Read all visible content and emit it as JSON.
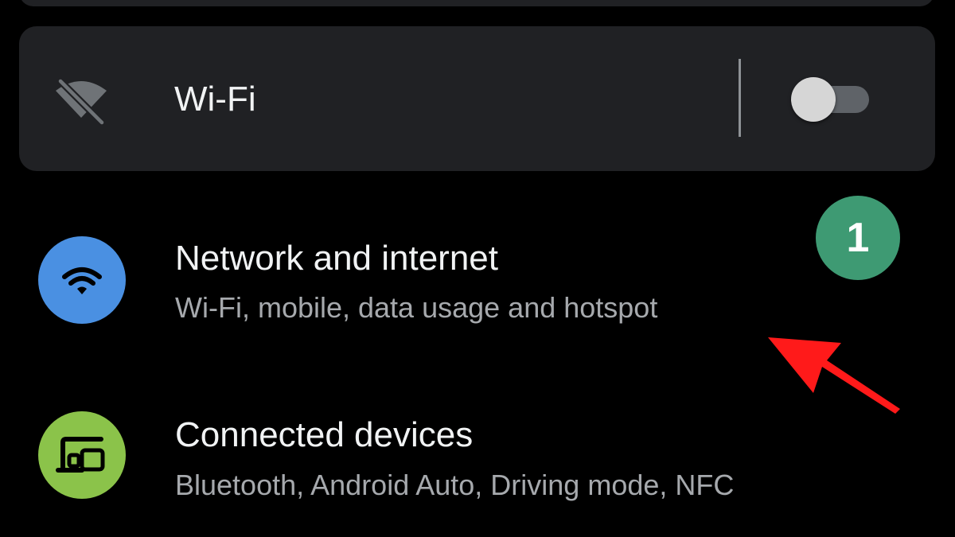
{
  "wifi_card": {
    "title": "Wi-Fi",
    "icon": "wifi-off-icon",
    "toggle_state": "off"
  },
  "settings_items": [
    {
      "title": "Network and internet",
      "subtitle": "Wi-Fi, mobile, data usage and hotspot",
      "icon": "wifi-icon",
      "icon_color": "#4a90e2"
    },
    {
      "title": "Connected devices",
      "subtitle": "Bluetooth, Android Auto, Driving mode, NFC",
      "icon": "devices-icon",
      "icon_color": "#8bc34a"
    }
  ],
  "annotation": {
    "step_number": "1",
    "badge_color": "#3e9a73",
    "arrow_color": "#ff1a1a"
  },
  "colors": {
    "background": "#000000",
    "card": "#202124"
  }
}
